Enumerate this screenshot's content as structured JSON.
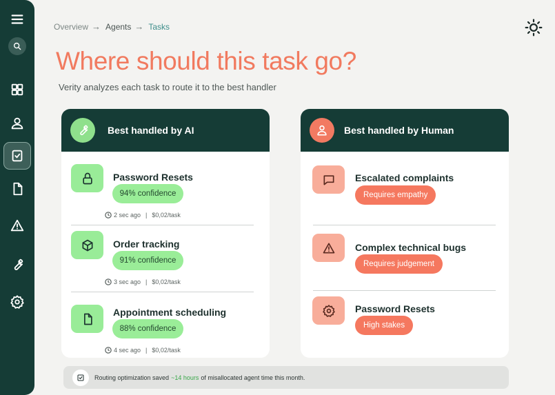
{
  "breadcrumb": {
    "items": [
      "Overview",
      "Agents",
      "Tasks"
    ]
  },
  "header": {
    "title": "Where should this task go?",
    "subtitle": "Verity analyzes each task to route it to the best handler"
  },
  "panels": {
    "ai": {
      "title": "Best handled by AI",
      "tasks": [
        {
          "name": "Password Resets",
          "confidence": "94% confidence",
          "time": "2 sec ago",
          "cost": "$0,02/task",
          "icon": "lock-icon"
        },
        {
          "name": "Order tracking",
          "confidence": "91% confidence",
          "time": "3 sec ago",
          "cost": "$0,02/task",
          "icon": "package-icon"
        },
        {
          "name": "Appointment scheduling",
          "confidence": "88% confidence",
          "time": "4 sec ago",
          "cost": "$0,02/task",
          "icon": "document-icon"
        }
      ]
    },
    "human": {
      "title": "Best handled by Human",
      "tasks": [
        {
          "name": "Escalated complaints",
          "reason": "Requires empathy",
          "icon": "chat-bubble-icon"
        },
        {
          "name": "Complex technical bugs",
          "reason": "Requires judgement",
          "icon": "warning-icon"
        },
        {
          "name": "Password Resets",
          "reason": "High stakes",
          "icon": "gear-icon"
        }
      ]
    }
  },
  "footer": {
    "prefix": "Routing optimization saved",
    "highlight": "~14 hours",
    "suffix": "of misallocated agent time this month."
  },
  "colors": {
    "sidebar": "#153c36",
    "accent_orange": "#f17a5f",
    "ai_green": "#9aed98",
    "human_orange": "#f5785f",
    "background": "#f3f3f1"
  },
  "icons": {
    "sidebar": [
      "menu-icon",
      "search-icon",
      "dashboard-icon",
      "user-icon",
      "tasks-icon",
      "file-icon",
      "alert-icon",
      "wrench-icon",
      "settings-icon"
    ],
    "theme": "sun-icon"
  }
}
